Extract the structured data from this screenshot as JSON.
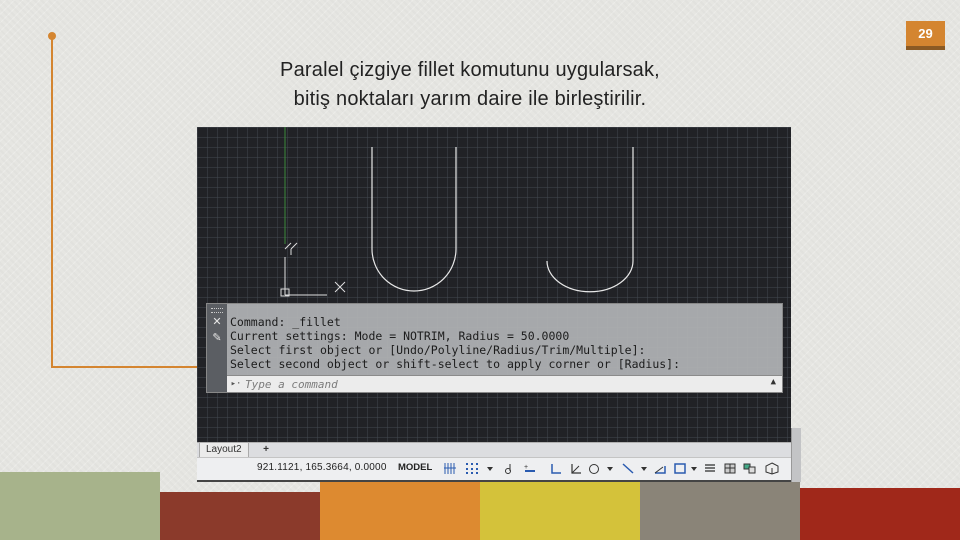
{
  "slide": {
    "number": "29"
  },
  "title": {
    "line1": "Paralel çizgiye fillet komutunu uygularsak,",
    "line2": "bitiş noktaları yarım daire ile birleştirilir."
  },
  "cad": {
    "axis_labels": {
      "y": "Y",
      "x": "X"
    },
    "command_history": [
      "Command: _fillet",
      "Current settings: Mode = NOTRIM, Radius = 50.0000",
      "Select first object or [Undo/Polyline/Radius/Trim/Multiple]:",
      "Select second object or shift-select to apply corner or [Radius]:"
    ],
    "command_input": {
      "prompt_icon": "▸·",
      "placeholder": "Type a command"
    },
    "layout_tab": "Layout2",
    "layout_add": "+",
    "status": {
      "coordinates": "921.1121, 165.3664, 0.0000",
      "model": "MODEL"
    },
    "status_icons": [
      "grid-icon",
      "snap-icon",
      "dropdown-icon",
      "infer-icon",
      "dynamic-input-icon",
      "ortho-icon",
      "polar-icon",
      "isodraft-icon",
      "object-snap-tracking-icon",
      "lineweight-icon",
      "annotation-scale-icon",
      "workspace-icon",
      "properties-icon",
      "isolate-icon",
      "hardware-icon"
    ]
  },
  "colors": {
    "accent_orange": "#d48530",
    "cad_background": "#212226",
    "geometry_white": "#e8e8e8",
    "ucs_green": "#3a8a3a"
  }
}
